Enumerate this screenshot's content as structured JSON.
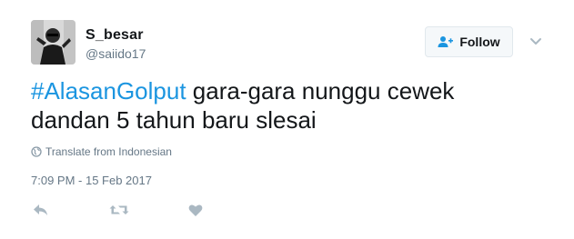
{
  "user": {
    "display_name": "S_besar",
    "screen_name": "@saiido17",
    "avatar_icon": "user-photo-avatar"
  },
  "follow_button": {
    "label": "Follow",
    "icon": "add-person-icon"
  },
  "menu": {
    "icon": "chevron-down-icon"
  },
  "tweet": {
    "hashtag": "#AlasanGolput",
    "text_line1": " gara-gara nunggu cewek",
    "text_line2": "dandan 5 tahun baru slesai"
  },
  "translate": {
    "label": "Translate from Indonesian",
    "icon": "globe-icon"
  },
  "timestamp": "7:09 PM - 15 Feb 2017",
  "actions": {
    "reply_icon": "reply-icon",
    "retweet_icon": "retweet-icon",
    "like_icon": "heart-icon"
  },
  "colors": {
    "hashtag": "#1b95e0",
    "text": "#14171a",
    "secondary": "#657786",
    "action_icon": "#aab8c2",
    "button_bg": "#f5f8fa",
    "button_border": "#e1e8ed"
  }
}
